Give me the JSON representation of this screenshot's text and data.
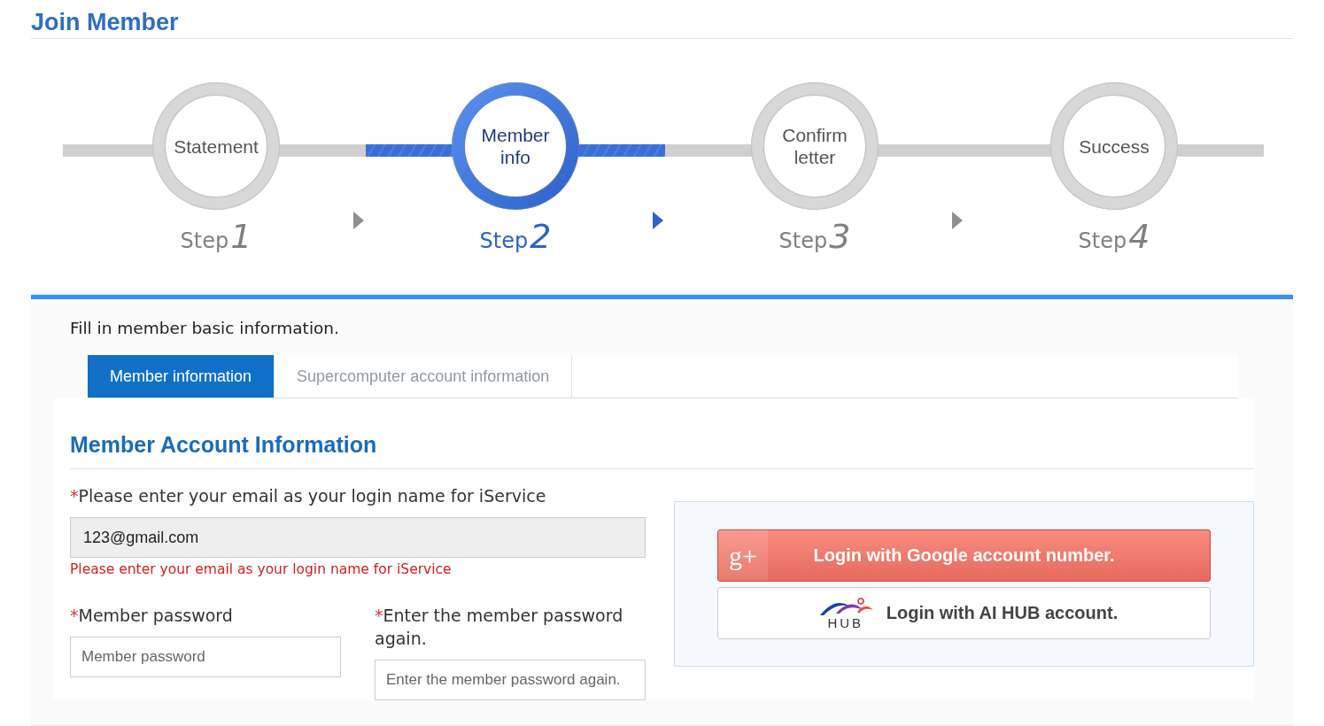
{
  "page_title": "Join Member",
  "steps": [
    {
      "label": "Statement",
      "step_word": "Step",
      "number": "1",
      "selected": false
    },
    {
      "label": "Member info",
      "step_word": "Step",
      "number": "2",
      "selected": true
    },
    {
      "label": "Confirm letter",
      "step_word": "Step",
      "number": "3",
      "selected": false
    },
    {
      "label": "Success",
      "step_word": "Step",
      "number": "4",
      "selected": false
    }
  ],
  "intro": "Fill in member basic information.",
  "tabs": [
    {
      "label": "Member information",
      "selected": true
    },
    {
      "label": "Supercomputer account information",
      "selected": false
    }
  ],
  "section_title": "Member Account Information",
  "email": {
    "label": "Please enter your email as your login name for iService",
    "required_mark": "*",
    "value": "123@gmail.com",
    "error": "Please enter your email as your login name for iService"
  },
  "password": {
    "label": "Member password",
    "required_mark": "*",
    "placeholder": "Member password"
  },
  "password_again": {
    "label": "Enter the member password again.",
    "required_mark": "*",
    "placeholder": "Enter the member password again."
  },
  "google_button": {
    "icon_text": "g+",
    "label": "Login with Google account number."
  },
  "aihub_button": {
    "logo_text": "HUB",
    "label": "Login with AI HUB account."
  }
}
